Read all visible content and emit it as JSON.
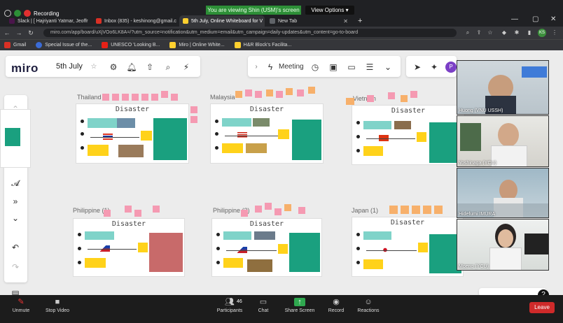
{
  "browser": {
    "recording_label": "Recording",
    "share_banner": "You are viewing Shin (USM)'s screen",
    "view_options": "View Options ▾",
    "tabs": [
      {
        "label": "Slack | [ Hajriyanti Yatmar, Jeoffr",
        "color": "#4a154b"
      },
      {
        "label": "Inbox (835) - keshinong@gmail.c",
        "color": "#d93025"
      },
      {
        "label": "5th July, Online Whiteboard for V",
        "color": "#ffd02f"
      },
      {
        "label": "New Tab",
        "color": "#5f6368"
      }
    ],
    "new_tab": "+",
    "url": "miro.com/app/board/uXjVOo6LK8A=/?utm_source=notification&utm_medium=email&utm_campaign=daily-updates&utm_content=go-to-board",
    "profile": "KS",
    "bookmarks": [
      {
        "label": "Gmail",
        "color": "#d93025"
      },
      {
        "label": "Special Issue of the...",
        "color": "#3b6bd6"
      },
      {
        "label": "UNESCO 'Looking B...",
        "color": "#e62117"
      },
      {
        "label": "Miro | Online White...",
        "color": "#ffd02f"
      },
      {
        "label": "H&R Block's Facilita...",
        "color": "#ffd02f"
      }
    ]
  },
  "miro": {
    "logo": "miro",
    "board_name": "5th July",
    "meeting_label": "Meeting",
    "frames": [
      {
        "label": "Thailand",
        "title": "Disaster",
        "flag": "thailand"
      },
      {
        "label": "Malaysia",
        "title": "Disaster",
        "flag": "malaysia"
      },
      {
        "label": "Vietnam",
        "title": "Disaster",
        "flag": "vietnam"
      },
      {
        "label": "Philippine (1)",
        "title": "Disaster",
        "flag": "philippines"
      },
      {
        "label": "Philippine (2)",
        "title": "Disaster",
        "flag": "philippines"
      },
      {
        "label": "Japan (1)",
        "title": "Disaster",
        "flag": "japan"
      }
    ],
    "zoom_label": "?"
  },
  "participants": [
    {
      "name": "Huong (VNU USSH)"
    },
    {
      "name": "Yoshinaga (YCU)"
    },
    {
      "name": "Hidefumi IMURA"
    },
    {
      "name": "Moeno (YCU)"
    }
  ],
  "zoom": {
    "unmute": "Unmute",
    "stop_video": "Stop Video",
    "participants": "Participants",
    "participants_count": "46",
    "chat": "Chat",
    "share_screen": "Share Screen",
    "record": "Record",
    "reactions": "Reactions",
    "leave": "Leave"
  },
  "colors": {
    "accent_green": "#1aa07f",
    "sticky_yellow": "#ffd21a",
    "sticky_pink": "#f59ab2",
    "leave_red": "#cf2a2a"
  }
}
